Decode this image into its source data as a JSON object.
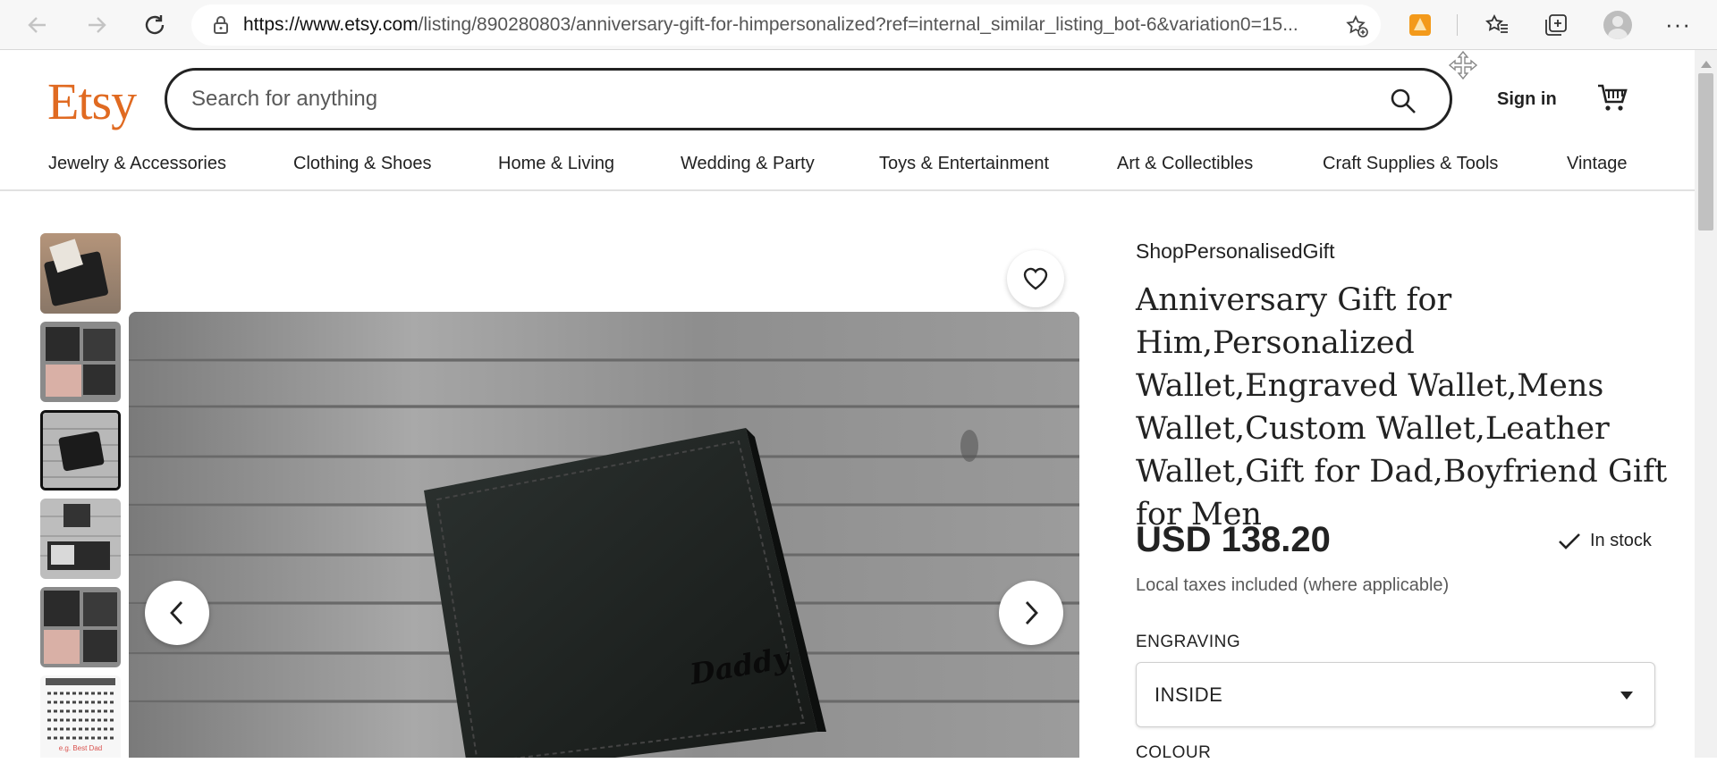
{
  "browser": {
    "url_host": "https://www.etsy.com",
    "url_path": "/listing/890280803/anniversary-gift-for-himpersonalized?ref=internal_similar_listing_bot-6&variation0=15...",
    "icons": [
      "back-icon",
      "forward-icon",
      "reload-icon",
      "lock-icon",
      "add-favorite-icon",
      "extension-icon",
      "favorites-icon",
      "collections-icon",
      "profile-icon",
      "more-icon"
    ]
  },
  "header": {
    "logo": "Etsy",
    "search_placeholder": "Search for anything",
    "sign_in": "Sign in"
  },
  "categories": [
    "Jewelry & Accessories",
    "Clothing & Shoes",
    "Home & Living",
    "Wedding & Party",
    "Toys & Entertainment",
    "Art & Collectibles",
    "Craft Supplies & Tools",
    "Vintage"
  ],
  "gallery": {
    "thumbnail_count": 6,
    "active_index": 2,
    "engraving_text": "Daddy",
    "sample_caption": "e.g. Best Dad"
  },
  "product": {
    "shop_name": "ShopPersonalisedGift",
    "title": "Anniversary Gift for Him,Personalized Wallet,Engraved Wallet,Mens Wallet,Custom Wallet,Leather Wallet,Gift for Dad,Boyfriend Gift for Men",
    "price": "USD 138.20",
    "stock": "In stock",
    "tax_note": "Local taxes included (where applicable)",
    "engraving_label": "ENGRAVING",
    "engraving_value": "INSIDE",
    "colour_label": "COLOUR"
  },
  "colors": {
    "brand": "#e06a21",
    "text": "#222222"
  }
}
